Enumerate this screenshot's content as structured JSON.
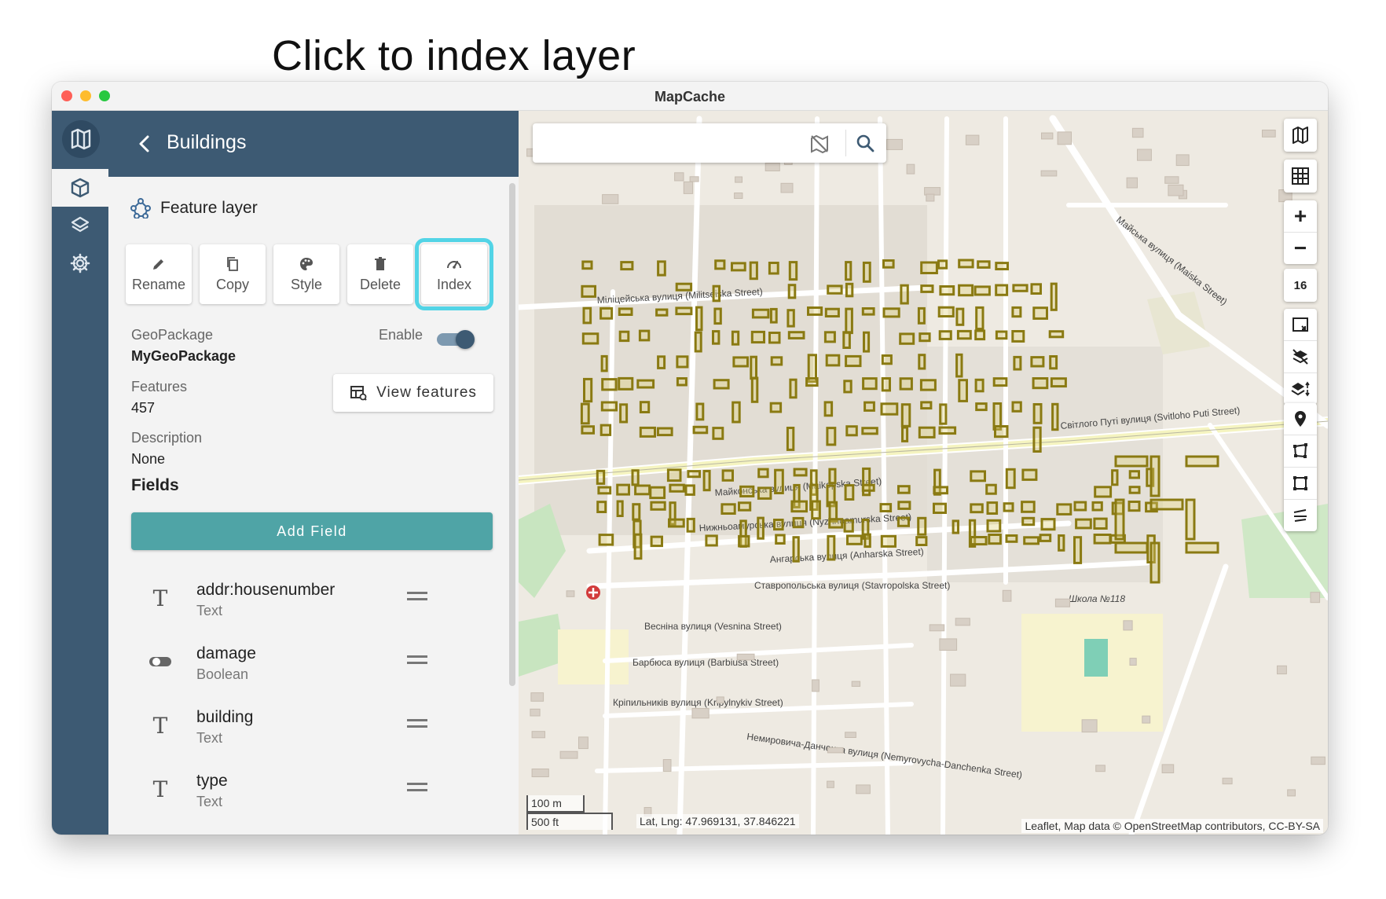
{
  "callout": {
    "text": "Click to index layer"
  },
  "window": {
    "title": "MapCache"
  },
  "panel": {
    "title": "Buildings",
    "layer_type": "Feature layer",
    "actions": [
      {
        "label": "Rename"
      },
      {
        "label": "Copy"
      },
      {
        "label": "Style"
      },
      {
        "label": "Delete"
      },
      {
        "label": "Index"
      }
    ],
    "geopackage_label": "GeoPackage",
    "geopackage_value": "MyGeoPackage",
    "enable_label": "Enable",
    "enabled": true,
    "features_label": "Features",
    "features_value": "457",
    "view_features_label": "View features",
    "description_label": "Description",
    "description_value": "None",
    "fields_heading": "Fields",
    "add_field_label": "Add Field",
    "fields": [
      {
        "name": "addr:housenumber",
        "type": "Text",
        "icon": "text-type-icon"
      },
      {
        "name": "damage",
        "type": "Boolean",
        "icon": "boolean-toggle-icon"
      },
      {
        "name": "building",
        "type": "Text",
        "icon": "text-type-icon"
      },
      {
        "name": "type",
        "type": "Text",
        "icon": "text-type-icon"
      }
    ]
  },
  "map": {
    "zoom_level": "16",
    "scale_metric": "100 m",
    "scale_imperial": "500 ft",
    "coordinates": "Lat, Lng: 47.969131, 37.846221",
    "attribution": "Leaflet, Map data © OpenStreetMap contributors, CC-BY-SA",
    "streets": [
      "Міліцейська вулиця (Militseiska Street)",
      "Світлого Путі вулиця (Svitloho Puti Street)",
      "Майконська вулиця (Maikopska Street)",
      "Нижньоамурська вулиця (Nyzhnoamurska Street)",
      "Ангарська вулиця (Anharska Street)",
      "Ставропольська вулиця (Stavropolska Street)",
      "Весніна вулиця (Vesnina Street)",
      "Барбюса вулиця (Barbiusa Street)",
      "Кріпильників вулиця (Kripylnykiv Street)",
      "Немировича-Данченка вулиця (Nemyrovycha-Danchenka Street)",
      "Майська вулиця (Maiska Street)",
      "Школа №118"
    ],
    "building_color": "#8a7a12"
  }
}
